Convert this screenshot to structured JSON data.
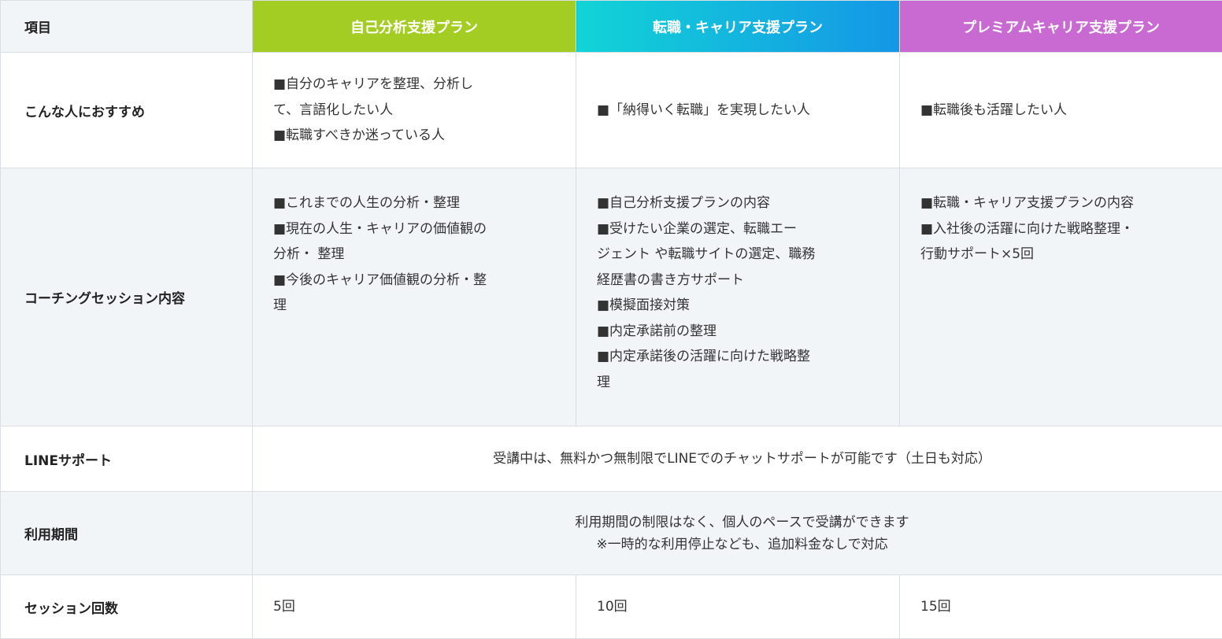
{
  "header": {
    "item": "項目",
    "plans": [
      "自己分析支援プラン",
      "転職・キャリア支援プラン",
      "プレミアムキャリア支援プラン"
    ]
  },
  "rows": {
    "recommended": {
      "label": "こんな人におすすめ",
      "plan1": [
        "■自分のキャリアを整理、分析し",
        "て、言語化したい人",
        "■転職すべきか迷っている人"
      ],
      "plan2": "■「納得いく転職」を実現したい人",
      "plan3": "■転職後も活躍したい人"
    },
    "coaching": {
      "label": "コーチングセッション内容",
      "plan1": [
        "■これまでの人生の分析・整理",
        "■現在の人生・キャリアの価値観の",
        "分析・ 整理",
        "■今後のキャリア価値観の分析・整",
        "理"
      ],
      "plan2": [
        "■自己分析支援プランの内容",
        "■受けたい企業の選定、転職エー",
        "ジェント や転職サイトの選定、職務",
        "経歴書の書き方サポート",
        "■模擬面接対策",
        "■内定承諾前の整理",
        "■内定承諾後の活躍に向けた戦略整",
        "理"
      ],
      "plan3": [
        "■転職・キャリア支援プランの内容",
        "■入社後の活躍に向けた戦略整理・",
        "行動サポート×5回"
      ]
    },
    "line_support": {
      "label": "LINEサポート",
      "text": "受講中は、無料かつ無制限でLINEでのチャットサポートが可能です（土日も対応）"
    },
    "period": {
      "label": "利用期間",
      "text": [
        "利用期間の制限はなく、個人のペースで受講ができます",
        "※一時的な利用停止なども、追加料金なしで対応"
      ]
    },
    "sessions": {
      "label": "セッション回数",
      "plan1": "5回",
      "plan2": "10回",
      "plan3": "15回"
    }
  },
  "colors": {
    "plan1": "#a4cd23",
    "plan2_start": "#12d4d6",
    "plan2_end": "#1497e6",
    "plan3": "#c86ad2",
    "row_gray": "#f2f5f8",
    "border": "#d9dee4"
  }
}
